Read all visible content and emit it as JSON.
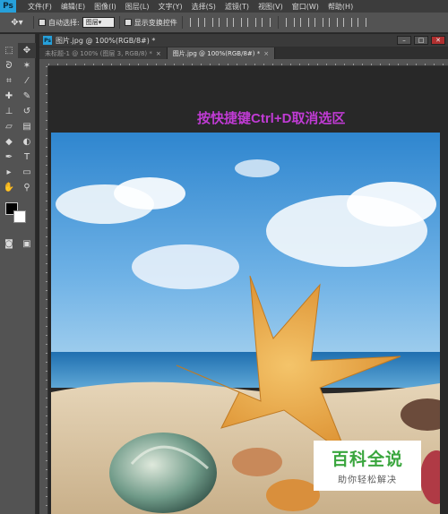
{
  "app": {
    "logo": "Ps"
  },
  "menu": {
    "items": [
      "文件(F)",
      "编辑(E)",
      "图像(I)",
      "图层(L)",
      "文字(Y)",
      "选择(S)",
      "滤镜(T)",
      "视图(V)",
      "窗口(W)",
      "帮助(H)"
    ]
  },
  "options": {
    "auto_select_label": "自动选择:",
    "auto_select_value": "图层",
    "show_transform_label": "显示变换控件"
  },
  "document": {
    "window_title": "图片.jpg @ 100%(RGB/8#) *",
    "tabs": [
      {
        "label": "未标题-1 @ 100% (图层 3, RGB/8) *",
        "active": false
      },
      {
        "label": "图片.jpg @ 100%(RGB/8#) *",
        "active": true
      }
    ],
    "tab_close": "×"
  },
  "canvas": {
    "instruction": "按快捷键Ctrl+D取消选区",
    "instruction_color": "#c03bd4"
  },
  "watermark": {
    "main": "百科全说",
    "sub": "助你轻松解决",
    "main_color": "#3aa63e"
  },
  "colors": {
    "foreground": "#000000",
    "background": "#ffffff"
  }
}
